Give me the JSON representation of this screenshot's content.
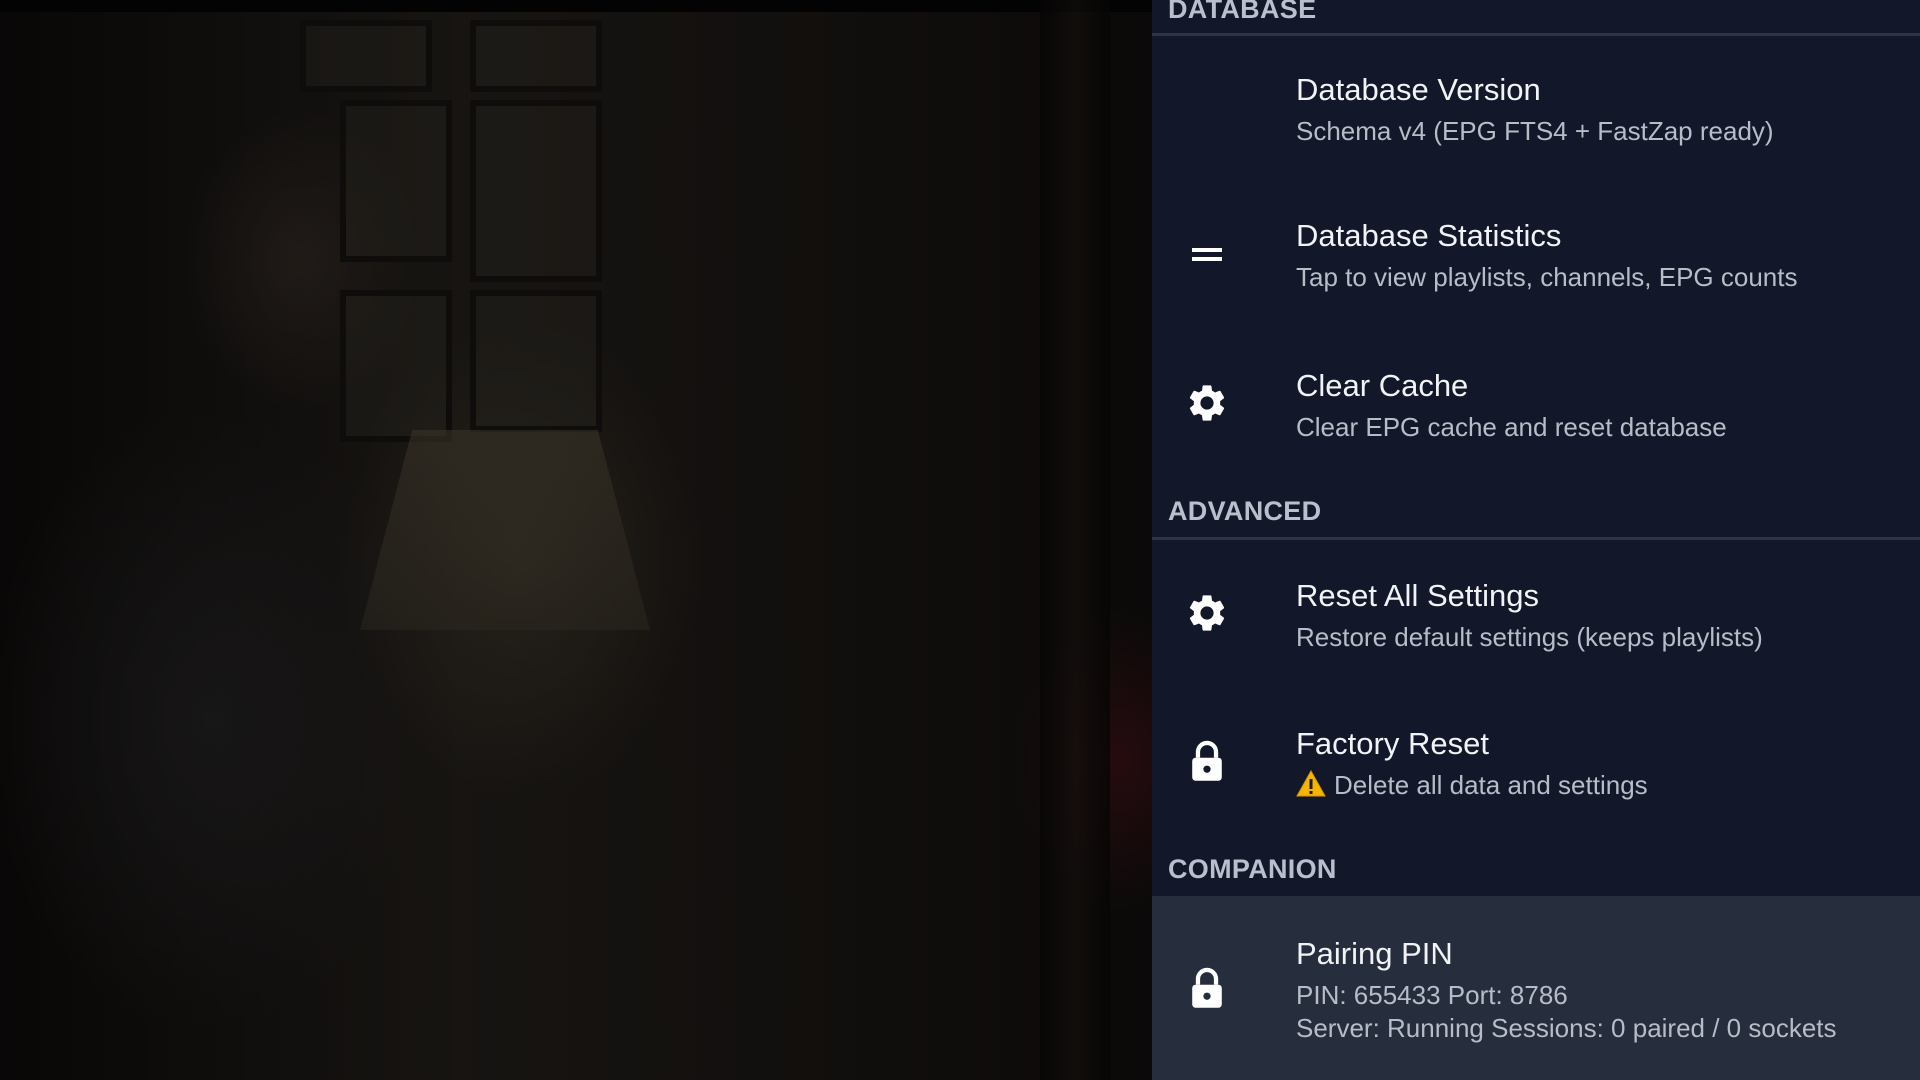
{
  "sections": {
    "database": "DATABASE",
    "advanced": "ADVANCED",
    "companion": "COMPANION"
  },
  "items": {
    "database_version": {
      "title": "Database Version",
      "subtitle": "Schema v4 (EPG FTS4 + FastZap ready)"
    },
    "database_statistics": {
      "title": "Database Statistics",
      "subtitle": "Tap to view playlists, channels, EPG counts",
      "icon": "equals-icon"
    },
    "clear_cache": {
      "title": "Clear Cache",
      "subtitle": "Clear EPG cache and reset database",
      "icon": "gear-icon"
    },
    "reset_all_settings": {
      "title": "Reset All Settings",
      "subtitle": "Restore default settings (keeps playlists)",
      "icon": "gear-icon"
    },
    "factory_reset": {
      "title": "Factory Reset",
      "subtitle": "Delete all data and settings",
      "icon": "lock-icon",
      "warning_icon": "warning-icon"
    },
    "pairing_pin": {
      "title": "Pairing PIN",
      "subtitle_line1": "PIN: 655433  Port: 8786",
      "subtitle_line2": "Server: Running  Sessions: 0 paired / 0 sockets",
      "icon": "lock-icon",
      "selected": true
    }
  },
  "colors": {
    "panel_bg": "#121829",
    "selected_bg": "#262d3d",
    "header_text": "#b9bfcc",
    "title_text": "#f2f3f7",
    "subtitle_text": "#b7bcc7",
    "warning": "#f4b400"
  }
}
